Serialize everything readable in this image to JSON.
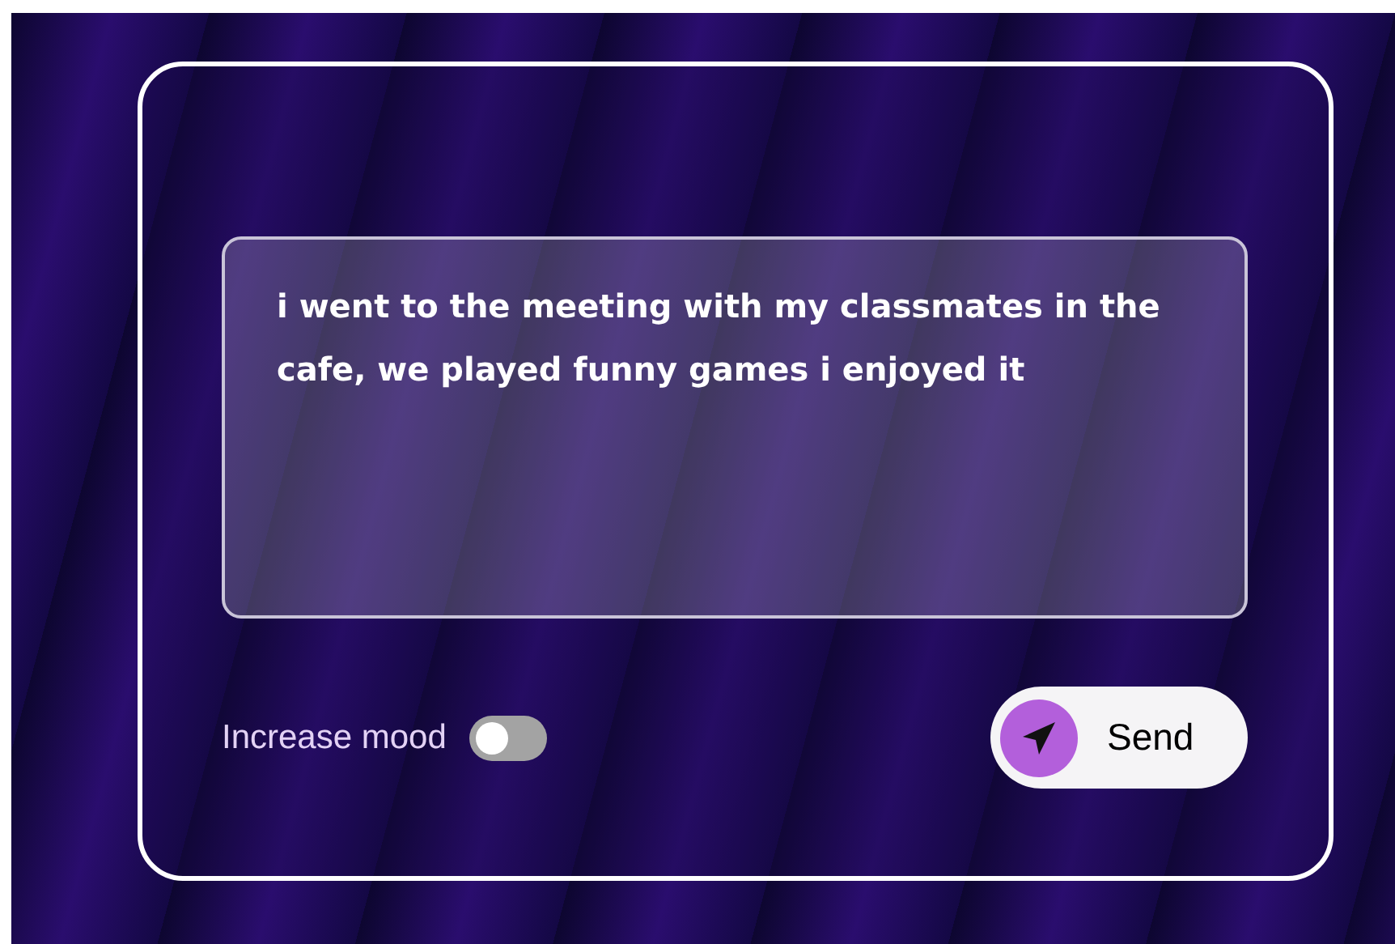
{
  "message": {
    "value": "i went to the meeting with my classmates in the cafe, we played funny games i enjoyed it"
  },
  "mood_toggle": {
    "label": "Increase mood",
    "on": false
  },
  "send_button": {
    "label": "Send"
  }
}
